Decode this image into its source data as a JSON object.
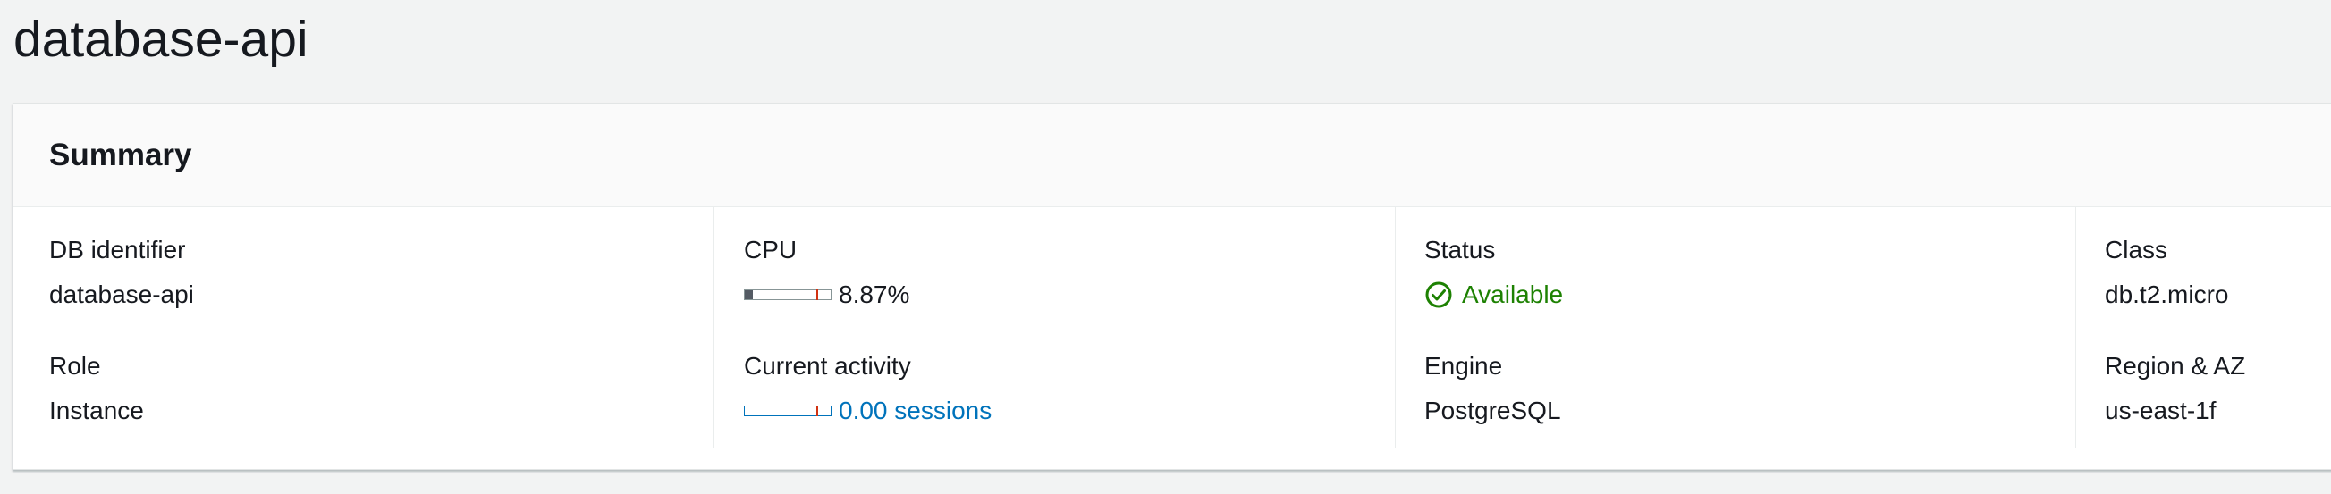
{
  "page": {
    "title": "database-api"
  },
  "summary": {
    "title": "Summary",
    "db_identifier": {
      "label": "DB identifier",
      "value": "database-api"
    },
    "role": {
      "label": "Role",
      "value": "Instance"
    },
    "cpu": {
      "label": "CPU",
      "value": "8.87%",
      "fill_fraction": 0.0887
    },
    "current_activity": {
      "label": "Current activity",
      "value": "0.00 sessions",
      "fill_fraction": 0.0
    },
    "status": {
      "label": "Status",
      "value": "Available",
      "icon": "check-circle-icon",
      "color": "#1d8102"
    },
    "engine": {
      "label": "Engine",
      "value": "PostgreSQL"
    },
    "class": {
      "label": "Class",
      "value": "db.t2.micro"
    },
    "region": {
      "label": "Region & AZ",
      "value": "us-east-1f"
    }
  },
  "colors": {
    "link": "#0073bb",
    "success": "#1d8102",
    "meter_threshold": "#d13212"
  }
}
